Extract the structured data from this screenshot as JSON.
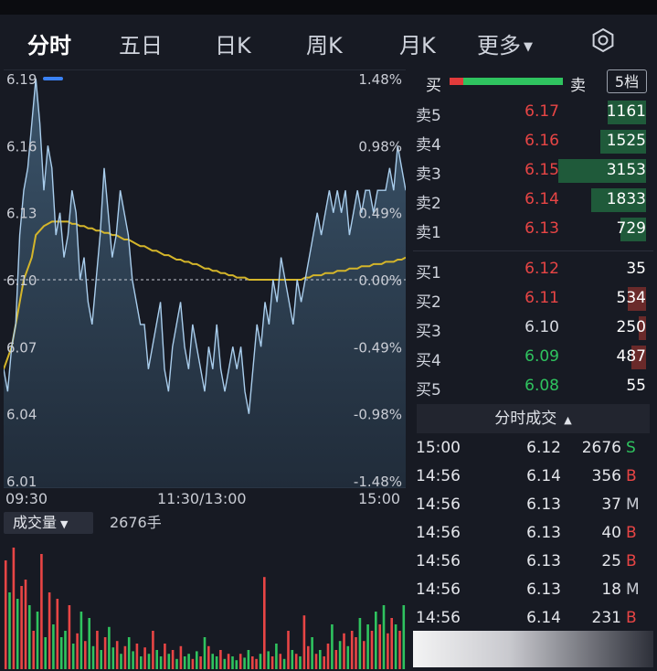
{
  "tabs": [
    {
      "label": "分时",
      "active": true
    },
    {
      "label": "五日"
    },
    {
      "label": "日K"
    },
    {
      "label": "周K"
    },
    {
      "label": "月K"
    },
    {
      "label": "更多"
    }
  ],
  "price_axis": [
    "6.19",
    "6.16",
    "6.13",
    "6.10",
    "6.07",
    "6.04",
    "6.01"
  ],
  "pct_axis": [
    "1.48%",
    "0.98%",
    "0.49%",
    "0.00%",
    "-0.49%",
    "-0.98%",
    "-1.48%"
  ],
  "time_axis": [
    "09:30",
    "11:30/13:00",
    "15:00"
  ],
  "volume": {
    "label": "成交量",
    "value": "2676手"
  },
  "orderbook": {
    "buy_label": "买",
    "sell_label": "卖",
    "buy_ratio": 0.12,
    "levels_button": "5档",
    "asks": [
      {
        "label": "卖5",
        "price": "6.17",
        "volume": "1161",
        "color": "#e84545"
      },
      {
        "label": "卖4",
        "price": "6.16",
        "volume": "1525",
        "color": "#e84545"
      },
      {
        "label": "卖3",
        "price": "6.15",
        "volume": "3153",
        "color": "#e84545"
      },
      {
        "label": "卖2",
        "price": "6.14",
        "volume": "1833",
        "color": "#e84545"
      },
      {
        "label": "卖1",
        "price": "6.13",
        "volume": "729",
        "color": "#e84545"
      }
    ],
    "bids": [
      {
        "label": "买1",
        "price": "6.12",
        "volume": "35",
        "color": "#e84545"
      },
      {
        "label": "买2",
        "price": "6.11",
        "volume": "534",
        "color": "#e84545"
      },
      {
        "label": "买3",
        "price": "6.10",
        "volume": "250",
        "color": "#d6d9e0"
      },
      {
        "label": "买4",
        "price": "6.09",
        "volume": "487",
        "color": "#2fc35f"
      },
      {
        "label": "买5",
        "price": "6.08",
        "volume": "55",
        "color": "#2fc35f"
      }
    ]
  },
  "ticks": {
    "title": "分时成交",
    "rows": [
      {
        "time": "15:00",
        "price": "6.12",
        "volume": "2676",
        "dir": "S",
        "dir_color": "#2fc35f"
      },
      {
        "time": "14:56",
        "price": "6.14",
        "volume": "356",
        "dir": "B",
        "dir_color": "#e84545"
      },
      {
        "time": "14:56",
        "price": "6.13",
        "volume": "37",
        "dir": "M",
        "dir_color": "#c9ccd4"
      },
      {
        "time": "14:56",
        "price": "6.13",
        "volume": "40",
        "dir": "B",
        "dir_color": "#e84545"
      },
      {
        "time": "14:56",
        "price": "6.13",
        "volume": "25",
        "dir": "B",
        "dir_color": "#e84545"
      },
      {
        "time": "14:56",
        "price": "6.13",
        "volume": "18",
        "dir": "M",
        "dir_color": "#c9ccd4"
      },
      {
        "time": "14:56",
        "price": "6.14",
        "volume": "231",
        "dir": "B",
        "dir_color": "#e84545"
      }
    ]
  },
  "chart_data": {
    "type": "line",
    "ylim": [
      6.01,
      6.19
    ],
    "prev_close": 6.1,
    "x": [
      0,
      1,
      2,
      3,
      4,
      5,
      6,
      7,
      8,
      9,
      10,
      11,
      12,
      13,
      14,
      15,
      16,
      17,
      18,
      19,
      20,
      21,
      22,
      23,
      24,
      25,
      26,
      27,
      28,
      29,
      30,
      31,
      32,
      33,
      34,
      35,
      36,
      37,
      38,
      39,
      40,
      41,
      42,
      43,
      44,
      45,
      46,
      47,
      48,
      49,
      50,
      51,
      52,
      53,
      54,
      55,
      56,
      57,
      58,
      59,
      60,
      61,
      62,
      63,
      64,
      65,
      66,
      67,
      68,
      69,
      70,
      71,
      72,
      73,
      74,
      75,
      76,
      77,
      78,
      79,
      80,
      81,
      82,
      83,
      84,
      85,
      86,
      87,
      88,
      89,
      90,
      91,
      92,
      93,
      94,
      95,
      96,
      97,
      98,
      99,
      100
    ],
    "series": [
      {
        "values": [
          6.06,
          6.05,
          6.07,
          6.08,
          6.12,
          6.14,
          6.15,
          6.17,
          6.19,
          6.17,
          6.14,
          6.16,
          6.15,
          6.12,
          6.13,
          6.11,
          6.12,
          6.14,
          6.13,
          6.1,
          6.11,
          6.09,
          6.08,
          6.1,
          6.12,
          6.15,
          6.13,
          6.11,
          6.12,
          6.14,
          6.13,
          6.12,
          6.1,
          6.09,
          6.08,
          6.08,
          6.06,
          6.07,
          6.08,
          6.09,
          6.06,
          6.05,
          6.07,
          6.08,
          6.09,
          6.07,
          6.06,
          6.08,
          6.07,
          6.06,
          6.05,
          6.07,
          6.06,
          6.08,
          6.06,
          6.05,
          6.06,
          6.07,
          6.06,
          6.07,
          6.05,
          6.04,
          6.06,
          6.08,
          6.07,
          6.09,
          6.08,
          6.1,
          6.09,
          6.11,
          6.1,
          6.09,
          6.08,
          6.1,
          6.09,
          6.1,
          6.11,
          6.12,
          6.13,
          6.12,
          6.13,
          6.14,
          6.13,
          6.14,
          6.13,
          6.14,
          6.12,
          6.13,
          6.14,
          6.13,
          6.14,
          6.14,
          6.13,
          6.14,
          6.14,
          6.14,
          6.15,
          6.14,
          6.16,
          6.15,
          6.14
        ]
      },
      {
        "values": [
          6.06,
          6.065,
          6.07,
          6.08,
          6.09,
          6.1,
          6.105,
          6.11,
          6.12,
          6.122,
          6.124,
          6.125,
          6.126,
          6.126,
          6.126,
          6.126,
          6.126,
          6.125,
          6.125,
          6.124,
          6.124,
          6.123,
          6.123,
          6.122,
          6.122,
          6.121,
          6.121,
          6.12,
          6.12,
          6.119,
          6.118,
          6.118,
          6.117,
          6.116,
          6.115,
          6.115,
          6.114,
          6.113,
          6.113,
          6.112,
          6.111,
          6.111,
          6.11,
          6.109,
          6.109,
          6.108,
          6.108,
          6.107,
          6.107,
          6.106,
          6.105,
          6.105,
          6.104,
          6.104,
          6.103,
          6.103,
          6.102,
          6.102,
          6.101,
          6.101,
          6.101,
          6.1,
          6.1,
          6.1,
          6.1,
          6.1,
          6.1,
          6.1,
          6.1,
          6.1,
          6.1,
          6.1,
          6.1,
          6.1,
          6.1,
          6.101,
          6.101,
          6.102,
          6.102,
          6.102,
          6.103,
          6.103,
          6.103,
          6.104,
          6.104,
          6.104,
          6.105,
          6.105,
          6.105,
          6.106,
          6.106,
          6.106,
          6.107,
          6.107,
          6.107,
          6.108,
          6.108,
          6.108,
          6.109,
          6.109,
          6.11
        ]
      }
    ],
    "volume_values": [
      0.85,
      0.6,
      0.95,
      0.55,
      0.65,
      0.7,
      0.5,
      0.3,
      0.45,
      0.9,
      0.25,
      0.6,
      0.35,
      0.55,
      0.25,
      0.3,
      0.5,
      0.2,
      0.28,
      0.45,
      0.22,
      0.4,
      0.18,
      0.3,
      0.15,
      0.25,
      0.33,
      0.17,
      0.22,
      0.12,
      0.18,
      0.25,
      0.14,
      0.2,
      0.1,
      0.17,
      0.12,
      0.3,
      0.15,
      0.1,
      0.2,
      0.12,
      0.15,
      0.08,
      0.18,
      0.1,
      0.12,
      0.08,
      0.14,
      0.1,
      0.25,
      0.18,
      0.12,
      0.1,
      0.15,
      0.08,
      0.12,
      0.1,
      0.07,
      0.12,
      0.09,
      0.15,
      0.1,
      0.08,
      0.12,
      0.72,
      0.14,
      0.1,
      0.2,
      0.12,
      0.08,
      0.3,
      0.15,
      0.12,
      0.1,
      0.42,
      0.18,
      0.25,
      0.12,
      0.15,
      0.1,
      0.2,
      0.35,
      0.15,
      0.22,
      0.28,
      0.18,
      0.3,
      0.25,
      0.4,
      0.22,
      0.35,
      0.3,
      0.45,
      0.35,
      0.5,
      0.28,
      0.4,
      0.35,
      0.3,
      0.5
    ],
    "volume_up": [
      true,
      false,
      true,
      false,
      true,
      true,
      false,
      true,
      false,
      true,
      false,
      true,
      false,
      true,
      false,
      false,
      true,
      false,
      true,
      false,
      true,
      false,
      false,
      true,
      false,
      true,
      false,
      false,
      true,
      false,
      true,
      false,
      false,
      true,
      false,
      true,
      false,
      true,
      false,
      false,
      true,
      false,
      true,
      false,
      true,
      false,
      false,
      true,
      false,
      true,
      false,
      true,
      false,
      false,
      true,
      false,
      true,
      false,
      false,
      true,
      false,
      false,
      true,
      true,
      false,
      true,
      false,
      true,
      false,
      true,
      false,
      true,
      false,
      true,
      false,
      true,
      true,
      false,
      true,
      false,
      true,
      true,
      false,
      true,
      false,
      true,
      false,
      true,
      true,
      false,
      true,
      false,
      true,
      false,
      true,
      false,
      true,
      true,
      false,
      true,
      false
    ]
  },
  "colors": {
    "price_line": "#a9cdec",
    "avg_line": "#d4b52a",
    "up": "#e84545",
    "down": "#2fc35f"
  }
}
